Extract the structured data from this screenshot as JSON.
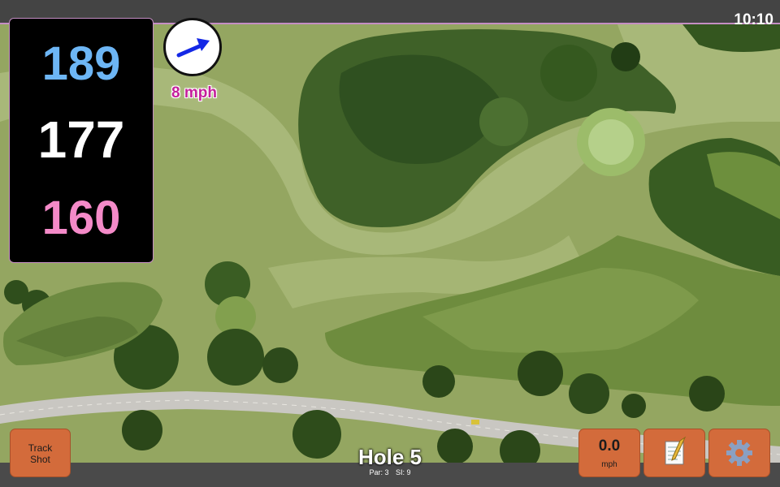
{
  "status": {
    "time": "10:10"
  },
  "distances": {
    "back": "189",
    "middle": "177",
    "front": "160"
  },
  "wind": {
    "speed": "8 mph",
    "icon": "wind-arrow-icon"
  },
  "hole": {
    "title": "Hole 5",
    "par": "Par: 3",
    "si": "SI: 9"
  },
  "buttons": {
    "track_shot": "Track Shot",
    "speed_value": "0.0",
    "speed_unit": "mph",
    "notes_icon": "notes-icon",
    "settings_icon": "gear-icon"
  },
  "colors": {
    "back": "#6db6f5",
    "middle": "#ffffff",
    "front": "#f48ac8",
    "wind_text": "#c41f9b",
    "button": "#d36b3b",
    "bar": "#444444"
  }
}
